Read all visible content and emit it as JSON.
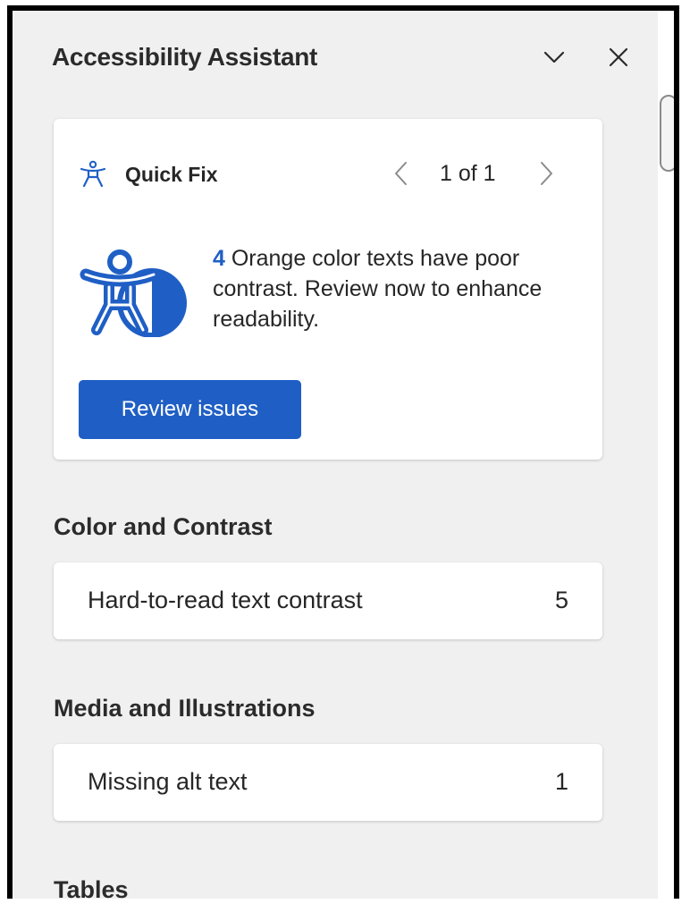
{
  "panel": {
    "title": "Accessibility Assistant",
    "collapse_icon": "chevron-down-icon",
    "close_icon": "close-icon"
  },
  "quick_fix": {
    "label": "Quick Fix",
    "icon": "accessibility-person-icon",
    "pager": {
      "current": "1",
      "total": "1",
      "text": "1 of 1"
    },
    "issue_count": "4",
    "description": " Orange color texts have poor contrast. Review now to enhance readability.",
    "illustration": "accessibility-contrast-illustration",
    "button_label": "Review issues"
  },
  "sections": [
    {
      "heading": "Color and Contrast",
      "items": [
        {
          "label": "Hard-to-read text contrast",
          "count": "5"
        }
      ]
    },
    {
      "heading": "Media and Illustrations",
      "items": [
        {
          "label": "Missing alt text",
          "count": "1"
        }
      ]
    },
    {
      "heading": "Tables",
      "items": []
    }
  ],
  "colors": {
    "accent": "#1f5fc5",
    "panel_background": "#f0f0f0",
    "card_background": "#ffffff",
    "text": "#262626"
  }
}
